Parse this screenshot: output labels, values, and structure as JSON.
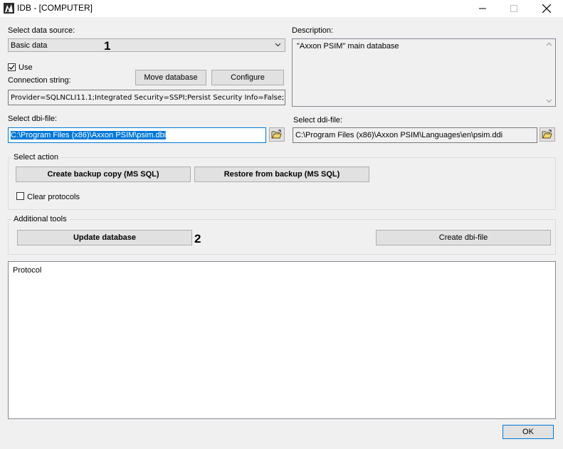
{
  "window": {
    "title": "IDB - [COMPUTER]",
    "icons": [
      "app-icon",
      "minimize-icon",
      "maximize-icon",
      "close-icon"
    ]
  },
  "data_source": {
    "label": "Select data source:",
    "selected": "Basic data",
    "marker": "1"
  },
  "description": {
    "label": "Description:",
    "text": "\"Axxon PSIM\" main database"
  },
  "use": {
    "label": "Use",
    "checked": true
  },
  "connection": {
    "label": "Connection string:",
    "value": "Provider=SQLNCLI11.1;Integrated Security=SSPI;Persist Security Info=False;I",
    "move_button": "Move database",
    "configure_button": "Configure"
  },
  "dbi": {
    "label": "Select dbi-file:",
    "value": "C:\\Program Files (x86)\\Axxon PSIM\\psim.dbi"
  },
  "ddi": {
    "label": "Select ddi-file:",
    "value": "C:\\Program Files (x86)\\Axxon PSIM\\Languages\\en\\psim.ddi"
  },
  "select_action": {
    "title": "Select action",
    "backup_button": "Create backup copy (MS SQL)",
    "restore_button": "Restore from backup (MS SQL)",
    "clear_protocols_label": "Clear protocols",
    "clear_protocols_checked": false
  },
  "additional_tools": {
    "title": "Additional tools",
    "update_button": "Update database",
    "marker": "2",
    "create_dbi_button": "Create dbi-file"
  },
  "protocol": {
    "label": "Protocol"
  },
  "footer": {
    "ok_button": "OK"
  }
}
